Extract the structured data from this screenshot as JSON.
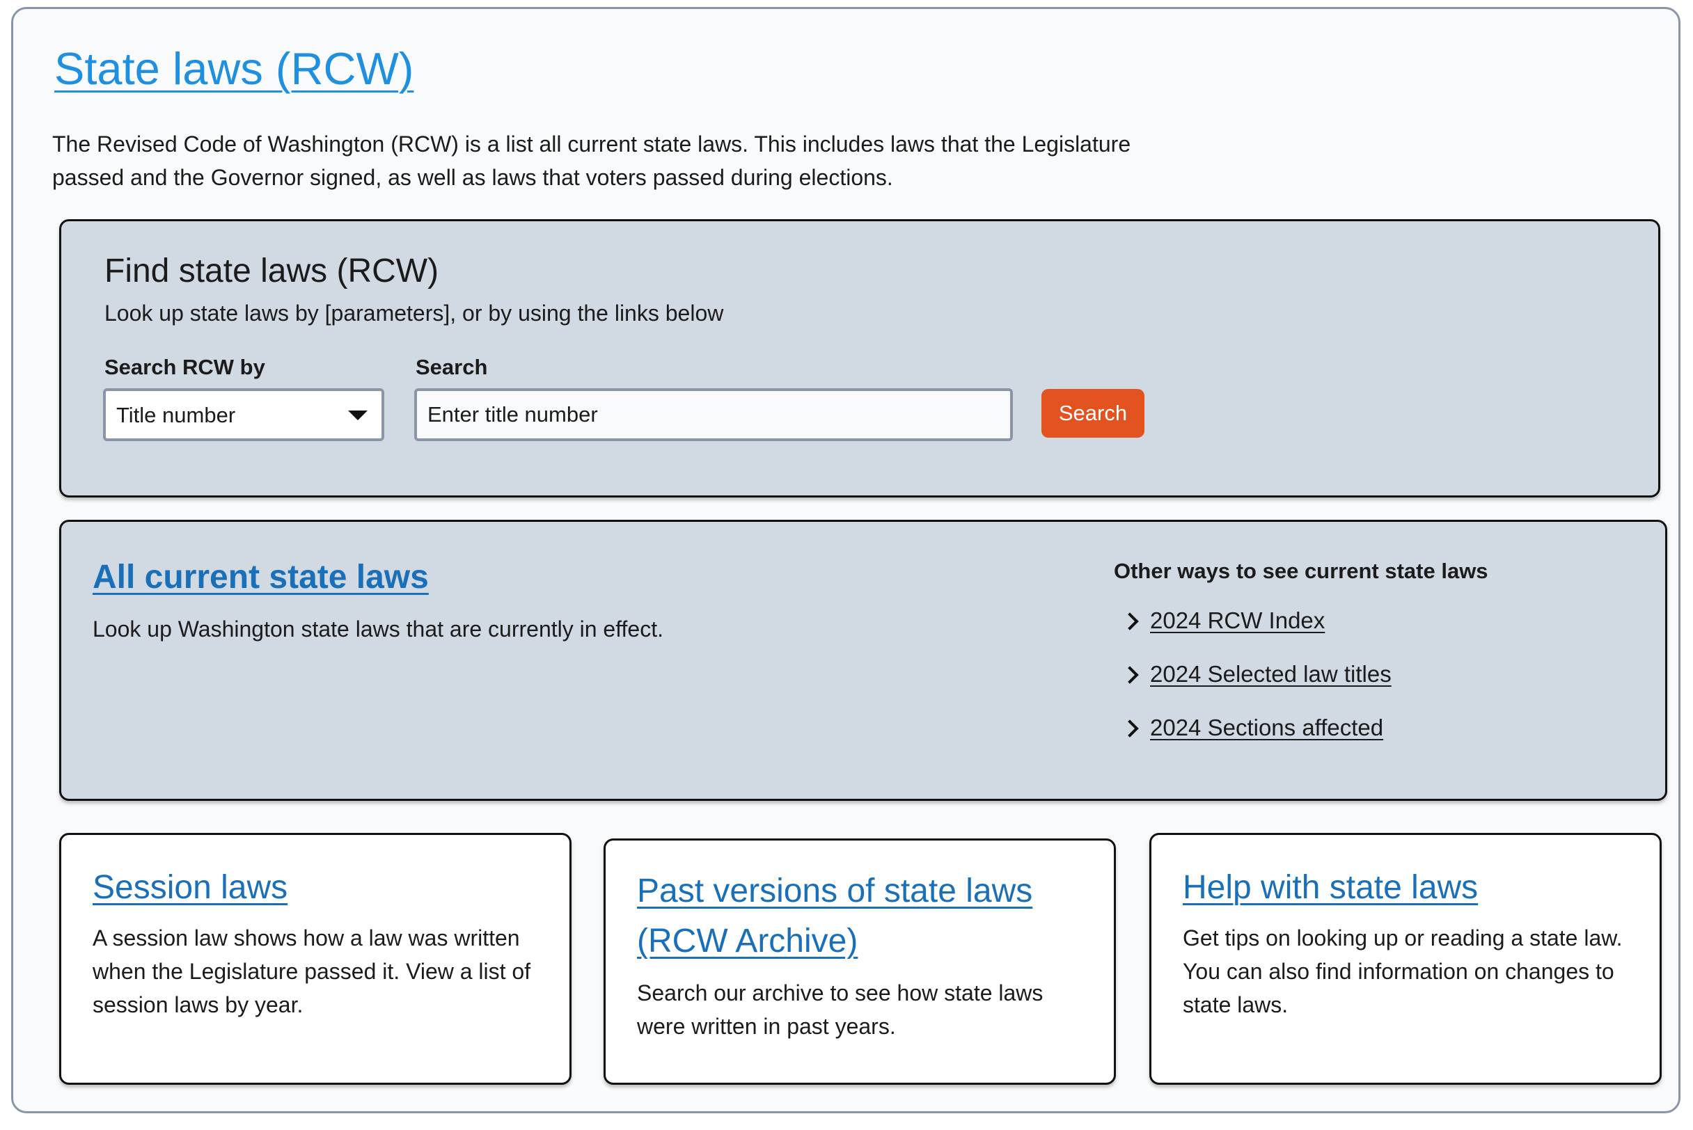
{
  "page": {
    "title": "State laws (RCW)",
    "intro": "The Revised Code of Washington (RCW) is a list all current state laws. This includes laws that the Legislature passed and the Governor signed, as well as laws that voters passed during elections."
  },
  "find": {
    "title": "Find state laws (RCW)",
    "subtitle": "Look up state laws by [parameters], or by using the links below",
    "search_by_label": "Search RCW by",
    "search_by_value": "Title number",
    "search_label": "Search",
    "search_placeholder": "Enter title number",
    "search_button": "Search"
  },
  "all_laws": {
    "title": "All current state laws",
    "description": "Look up Washington state laws that are currently in effect.",
    "other_title": "Other ways to see current state laws",
    "links": [
      {
        "label": "2024 RCW Index",
        "icon": "chevron-right-icon"
      },
      {
        "label": "2024 Selected law titles",
        "icon": "chevron-right-icon"
      },
      {
        "label": "2024 Sections affected",
        "icon": "chevron-right-icon"
      }
    ]
  },
  "cards": [
    {
      "title": "Session laws",
      "description": "A session law shows how a law was written when the Legislature passed it. View a list of session laws by year."
    },
    {
      "title": "Past versions of state laws (RCW Archive)",
      "description": "Search our archive to see how state laws were written in past years."
    },
    {
      "title": "Help with state laws",
      "description": "Get tips on looking up or reading a state law. You can also find information on changes to state laws."
    }
  ],
  "colors": {
    "link": "#1a70b8",
    "title_link": "#1f8fe0",
    "panel": "#d1d9e3",
    "button": "#e2531f"
  }
}
